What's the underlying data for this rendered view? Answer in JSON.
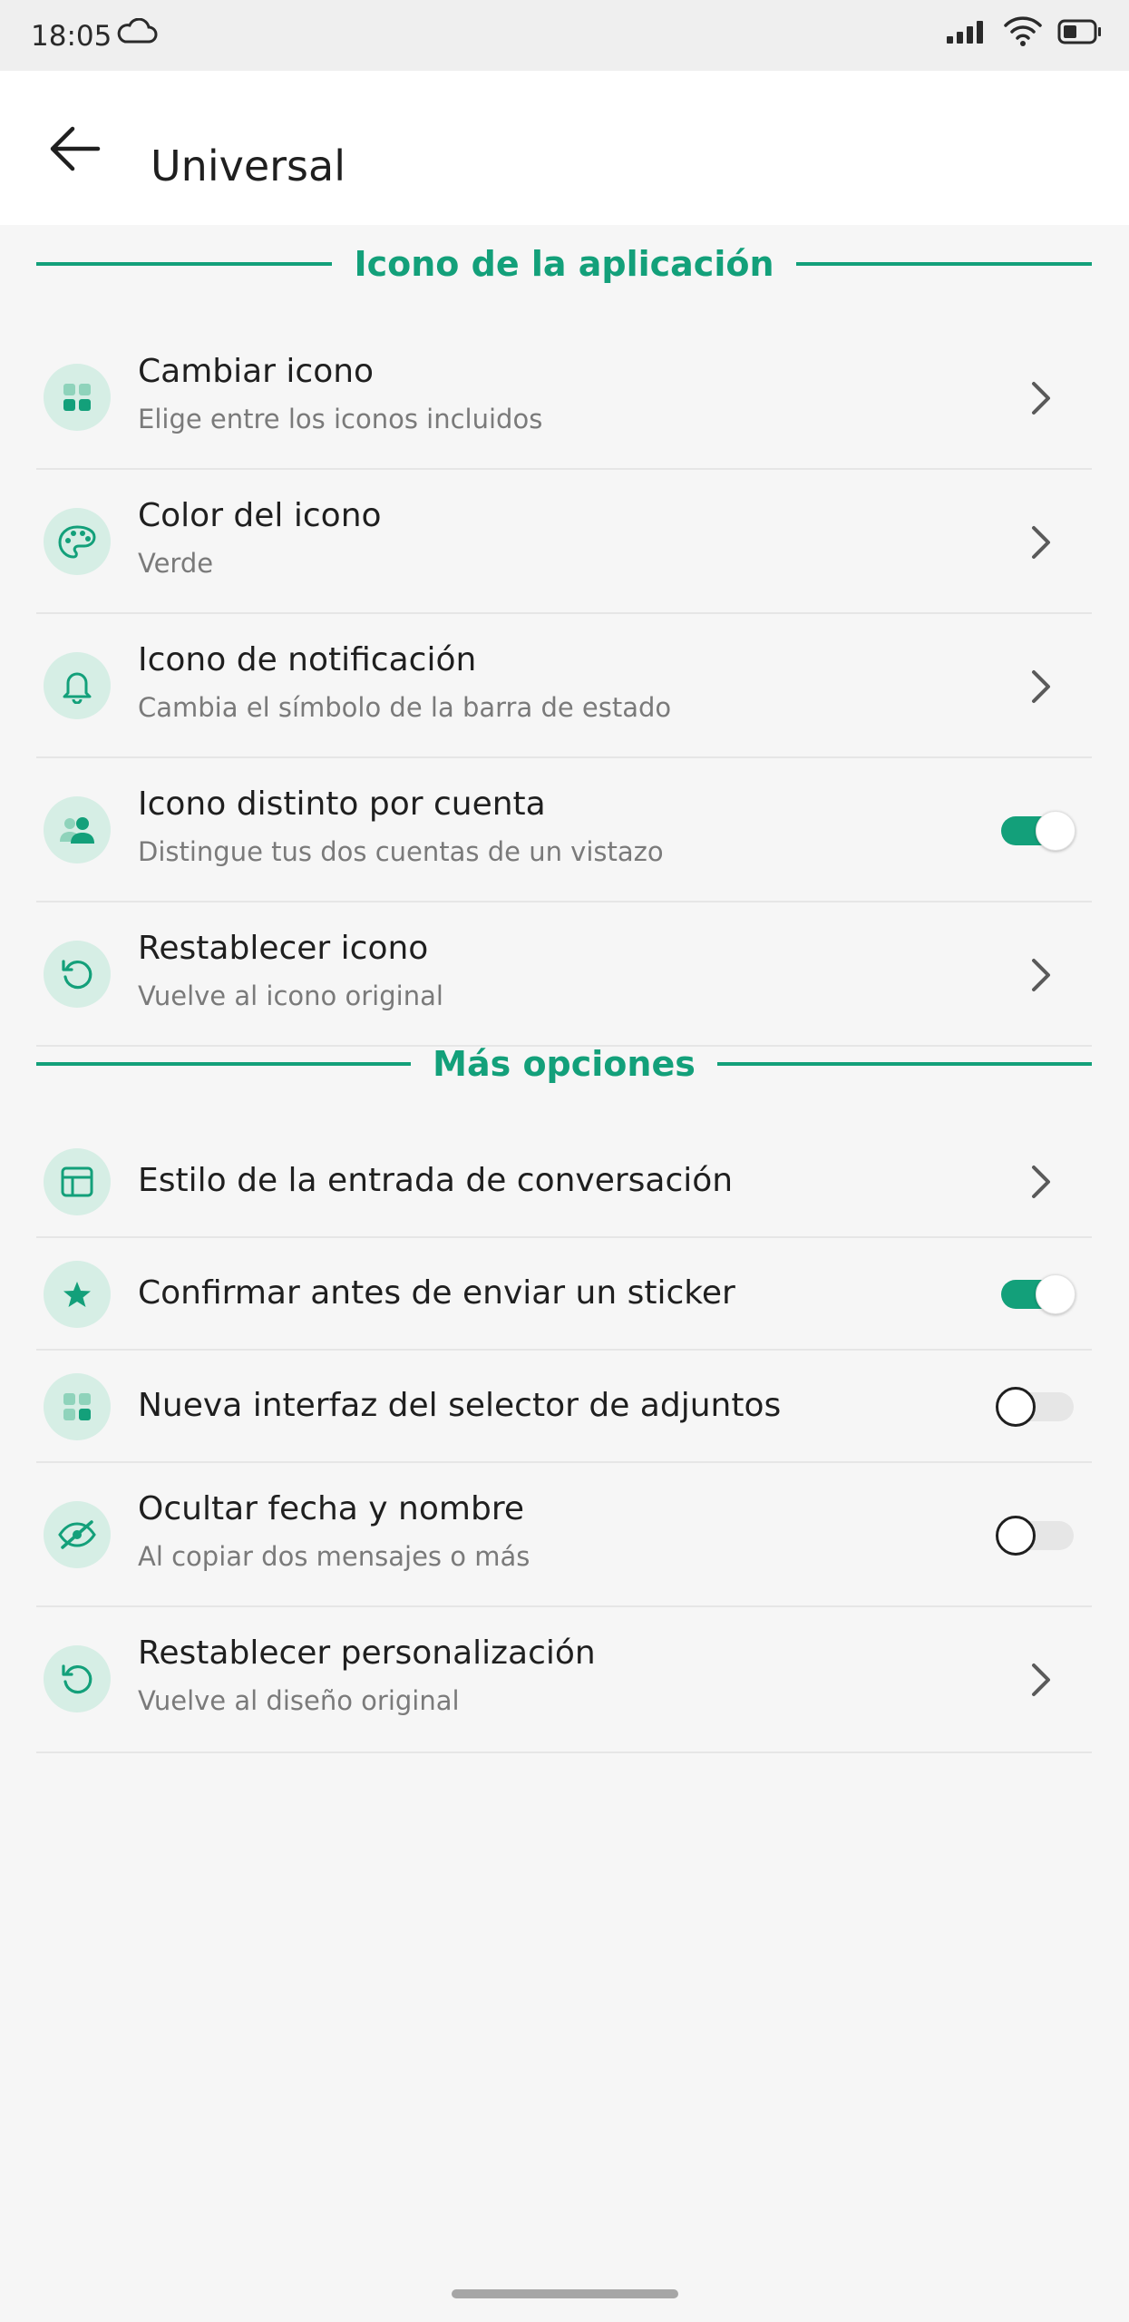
{
  "status_bar": {
    "time": "18:05"
  },
  "app_bar": {
    "title": "Universal"
  },
  "sections": [
    {
      "title": "Icono de la aplicación"
    },
    {
      "title": "Más opciones"
    }
  ],
  "rows": [
    {
      "title": "Cambiar icono",
      "subtitle": "Elige entre los iconos incluidos",
      "icon": "grid-icon",
      "control": "chevron"
    },
    {
      "title": "Color del icono",
      "subtitle": "Verde",
      "icon": "palette-icon",
      "control": "chevron"
    },
    {
      "title": "Icono de notificación",
      "subtitle": "Cambia el símbolo de la barra de estado",
      "icon": "bell-icon",
      "control": "chevron"
    },
    {
      "title": "Icono distinto por cuenta",
      "subtitle": "Distingue tus dos cuentas de un vistazo",
      "icon": "people-icon",
      "control": "toggle",
      "toggle_on": true
    },
    {
      "title": "Restablecer icono",
      "subtitle": "Vuelve al icono original",
      "icon": "reset-icon",
      "control": "chevron"
    },
    {
      "title": "Estilo de la entrada de conversación",
      "icon": "layout-icon",
      "control": "chevron"
    },
    {
      "title": "Confirmar antes de enviar un sticker",
      "icon": "star-icon",
      "control": "toggle",
      "toggle_on": true
    },
    {
      "title": "Nueva interfaz del selector de adjuntos",
      "icon": "grid-icon",
      "control": "toggle",
      "toggle_on": false
    },
    {
      "title": "Ocultar fecha y nombre",
      "subtitle": "Al copiar dos mensajes o más",
      "icon": "eye-off-icon",
      "control": "toggle",
      "toggle_on": false
    },
    {
      "title": "Restablecer personalización",
      "subtitle": "Vuelve al diseño original",
      "icon": "reset-icon",
      "control": "chevron"
    }
  ],
  "colors": {
    "accent": "#13a07a",
    "icon_bg": "#d6eee5",
    "background": "#f6f6f6"
  }
}
